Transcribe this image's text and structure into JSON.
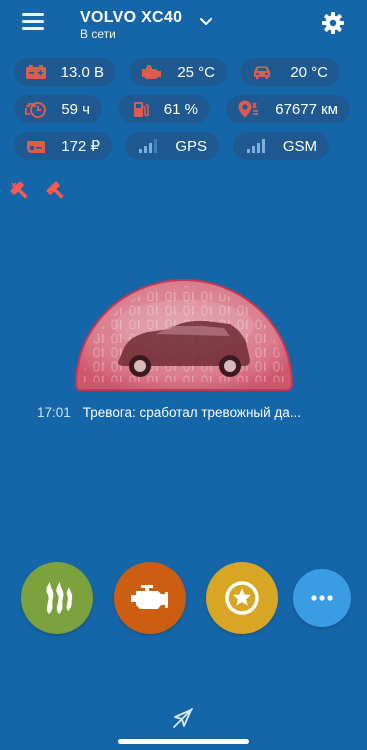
{
  "header": {
    "vehicle_name": "VOLVO XC40",
    "status": "В сети",
    "menu_icon": "hamburger-menu-icon",
    "dropdown_icon": "chevron-down-icon",
    "settings_icon": "gear-icon"
  },
  "telemetry": [
    {
      "icon": "battery-icon",
      "value": "13.0 В"
    },
    {
      "icon": "engine-temp-icon",
      "value": "25 °C"
    },
    {
      "icon": "car-interior-temp-icon",
      "value": "20 °C"
    },
    {
      "icon": "engine-hours-icon",
      "value": "59 ч"
    },
    {
      "icon": "fuel-icon",
      "value": "61 %"
    },
    {
      "icon": "odometer-location-icon",
      "value": "67677 км"
    },
    {
      "icon": "balance-card-icon",
      "value": "172 ₽"
    },
    {
      "icon": "gps-signal-icon",
      "value": "GPS"
    },
    {
      "icon": "gsm-signal-icon",
      "value": "GSM"
    }
  ],
  "alerts": [
    "hammer-alert-icon",
    "hammer-alert-icon"
  ],
  "last_event": {
    "time": "17:01",
    "text": "Тревога: сработал тревожный да..."
  },
  "actions": [
    {
      "icon": "heater-icon",
      "color": "#7ba23c"
    },
    {
      "icon": "engine-start-icon",
      "color": "#cc5e12"
    },
    {
      "icon": "favorite-star-icon",
      "color": "#d6a624"
    },
    {
      "icon": "more-icon",
      "color": "#3a9de3"
    }
  ],
  "colors": {
    "background": "#1566a8",
    "chip": "#1e5a91",
    "alert_red": "#ff5a52"
  },
  "bottom_icon": "no-location-icon"
}
